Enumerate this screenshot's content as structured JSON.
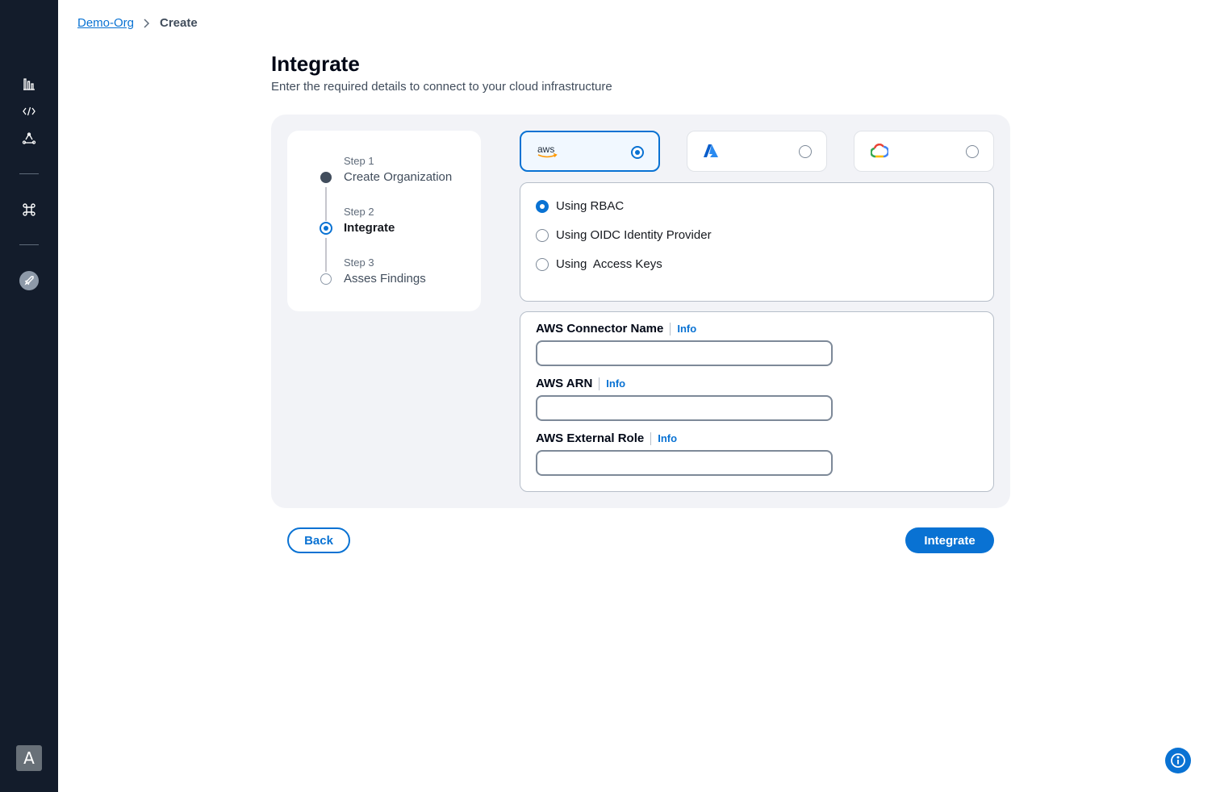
{
  "sidebar": {
    "icons": [
      "bar-chart-icon",
      "code-icon",
      "recycle-icon",
      "command-icon",
      "rocket-icon"
    ],
    "avatar_initial": "A"
  },
  "breadcrumb": {
    "items": [
      "Demo-Org",
      "Create"
    ]
  },
  "header": {
    "title": "Integrate",
    "subtitle": "Enter the required details to connect  to your cloud infrastructure"
  },
  "steps": [
    {
      "num": "Step 1",
      "name": "Create Organization",
      "state": "done"
    },
    {
      "num": "Step 2",
      "name": "Integrate",
      "state": "active"
    },
    {
      "num": "Step 3",
      "name": "Asses Findings",
      "state": "todo"
    }
  ],
  "providers": [
    {
      "name": "aws",
      "logo": "aws-logo",
      "selected": true
    },
    {
      "name": "Azure",
      "logo": "azure-logo",
      "selected": false
    },
    {
      "name": "Google Cloud",
      "logo": "google-cloud-logo",
      "selected": false
    }
  ],
  "auth_methods": [
    {
      "label": "Using RBAC",
      "selected": true
    },
    {
      "label": "Using OIDC Identity Provider",
      "selected": false
    },
    {
      "label": "Using  Access Keys",
      "selected": false
    }
  ],
  "form": {
    "fields": [
      {
        "label": "AWS Connector Name",
        "info": "Info",
        "value": ""
      },
      {
        "label": "AWS ARN",
        "info": "Info",
        "value": ""
      },
      {
        "label": "AWS External Role",
        "info": "Info",
        "value": ""
      }
    ]
  },
  "actions": {
    "back_label": "Back",
    "integrate_label": "Integrate"
  },
  "colors": {
    "sidebar_bg": "#131c2b",
    "accent": "#0972d3",
    "panel_bg": "#f2f3f7"
  }
}
